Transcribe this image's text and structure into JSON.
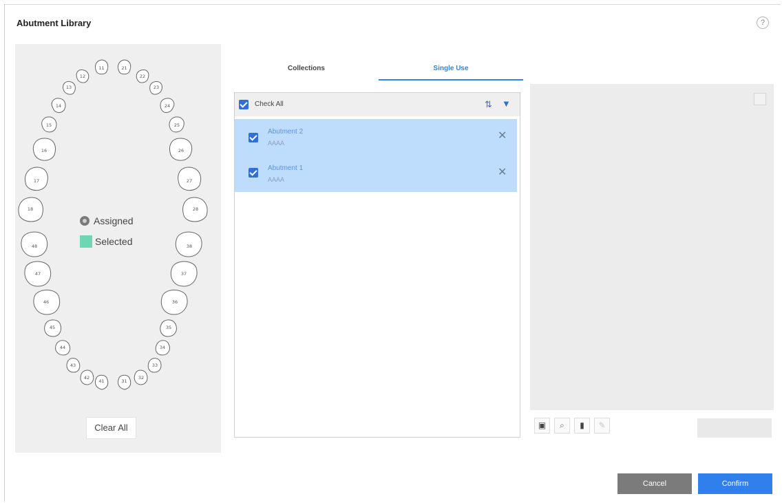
{
  "dialog": {
    "title": "Abutment Library",
    "help_label": "?"
  },
  "tooth_chart": {
    "teeth": [
      "11",
      "12",
      "13",
      "14",
      "15",
      "16",
      "17",
      "18",
      "21",
      "22",
      "23",
      "24",
      "25",
      "26",
      "27",
      "28",
      "31",
      "32",
      "33",
      "34",
      "35",
      "36",
      "37",
      "38",
      "41",
      "42",
      "43",
      "44",
      "45",
      "46",
      "47",
      "48"
    ],
    "legend": {
      "assigned": "Assigned",
      "selected": "Selected"
    },
    "legend_colors": {
      "assigned": "#7a7a7a",
      "selected": "#6fd6b4"
    },
    "clear_all": "Clear All"
  },
  "tabs": [
    {
      "label": "Collections",
      "active": false
    },
    {
      "label": "Single Use",
      "active": true
    }
  ],
  "list": {
    "check_all_label": "Check All",
    "sort_icon": "sort-icon",
    "filter_icon": "filter-icon",
    "items": [
      {
        "name": "Abutment 2",
        "sub": "AAAA",
        "checked": true
      },
      {
        "name": "Abutment 1",
        "sub": "AAAA",
        "checked": true
      }
    ]
  },
  "preview": {
    "tools": [
      "add-icon",
      "zoom-fit-icon",
      "delete-icon",
      "edit-icon"
    ]
  },
  "footer": {
    "cancel": "Cancel",
    "confirm": "Confirm"
  },
  "colors": {
    "accent": "#2f80ec",
    "row_selected": "#bedcfc",
    "cancel": "#7b7b7b"
  }
}
